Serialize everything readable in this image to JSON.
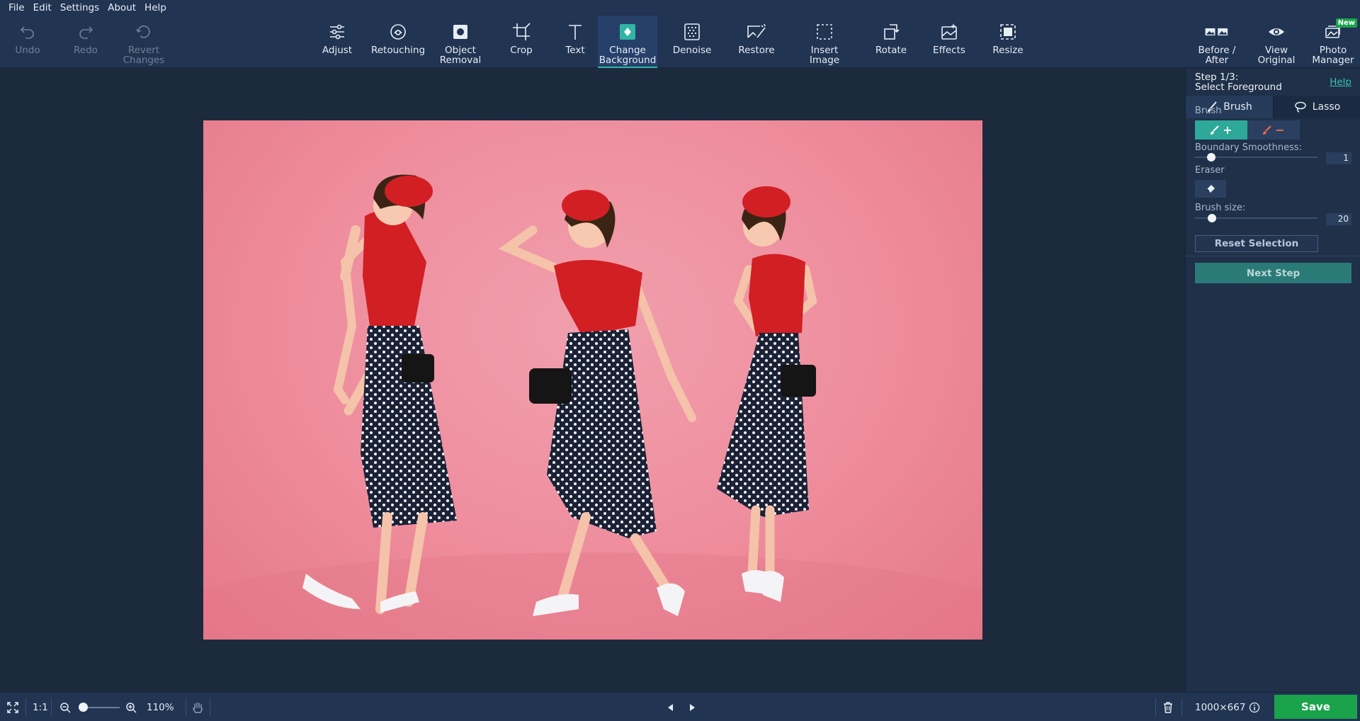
{
  "menu": [
    "File",
    "Edit",
    "Settings",
    "About",
    "Help"
  ],
  "toolbar": {
    "undo": "Undo",
    "redo": "Redo",
    "revert": "Revert\nChanges",
    "adjust": "Adjust",
    "retouching": "Retouching",
    "object_removal": "Object\nRemoval",
    "crop": "Crop",
    "text": "Text",
    "change_background": "Change\nBackground",
    "denoise": "Denoise",
    "restore": "Restore",
    "insert_image": "Insert\nImage",
    "rotate": "Rotate",
    "effects": "Effects",
    "resize": "Resize",
    "before_after": "Before /\nAfter",
    "view_original": "View\nOriginal",
    "photo_manager": "Photo\nManager",
    "new_badge": "New",
    "active_tool": "change_background"
  },
  "panel": {
    "step": "Step 1/3:",
    "step_title": "Select Foreground",
    "help": "Help",
    "tab_brush": "Brush",
    "tab_lasso": "Lasso",
    "brush_label": "Brush",
    "add_icon": "+",
    "sub_icon": "−",
    "boundary_label": "Boundary Smoothness:",
    "boundary_value": "1",
    "eraser_label": "Eraser",
    "brush_size_label": "Brush size:",
    "brush_size_value": "20",
    "reset": "Reset Selection",
    "next": "Next Step"
  },
  "status": {
    "actual_size": "1:1",
    "zoom": "110%",
    "dimensions": "1000×667",
    "save": "Save"
  },
  "colors": {
    "accent": "#2fb5a4",
    "save": "#1aa34a",
    "background": "#1c2a3d",
    "photo_bg": "#ef8e9d"
  }
}
